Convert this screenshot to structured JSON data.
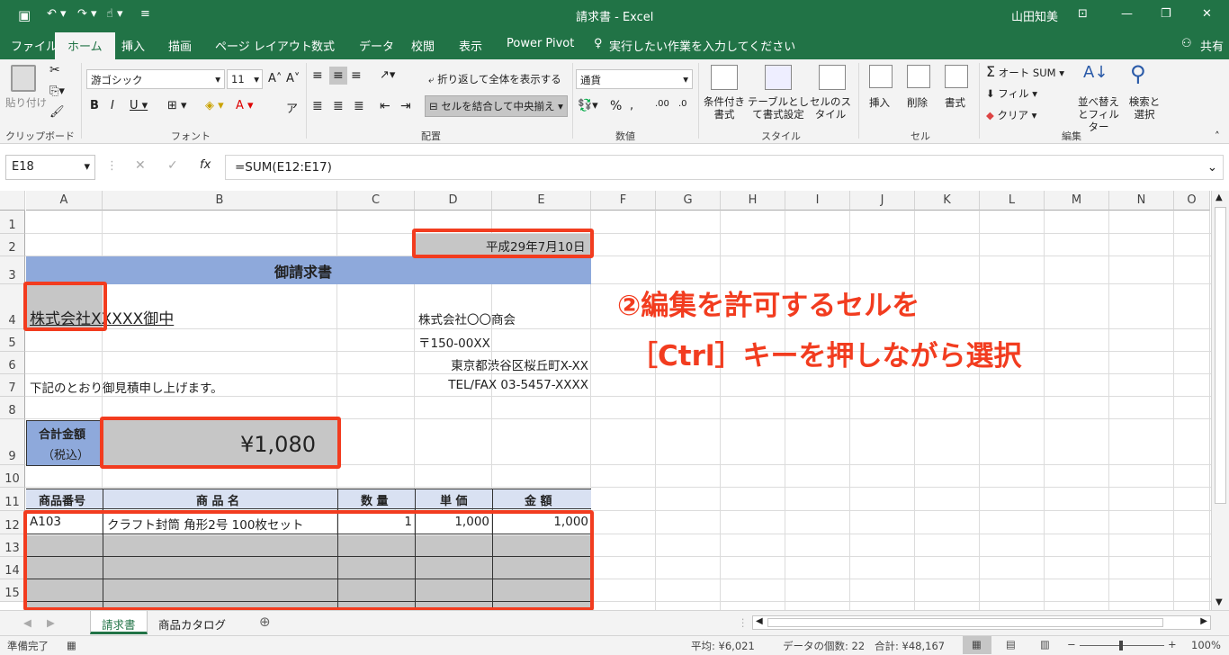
{
  "title": "請求書 - Excel",
  "user": "山田知美",
  "tabs": [
    "ファイル",
    "ホーム",
    "挿入",
    "描画",
    "ページ レイアウト",
    "数式",
    "データ",
    "校閲",
    "表示",
    "Power Pivot",
    "実行したい作業を入力してください"
  ],
  "share": "共有",
  "ribbon": {
    "paste": "貼り付け",
    "clipboard": "クリップボード",
    "font_name": "游ゴシック",
    "font_size": "11",
    "font_group": "フォント",
    "wrap": "折り返して全体を表示する",
    "merge": "セルを結合して中央揃え",
    "align_group": "配置",
    "number_format": "通貨",
    "number_group": "数値",
    "cond_format": "条件付き書式",
    "table_format": "テーブルとして書式設定",
    "cell_style": "セルのスタイル",
    "style_group": "スタイル",
    "insert": "挿入",
    "delete": "削除",
    "format": "書式",
    "cells_group": "セル",
    "autosum": "オート SUM",
    "fill": "フィル",
    "clear": "クリア",
    "sort": "並べ替えとフィルター",
    "find": "検索と選択",
    "edit_group": "編集"
  },
  "namebox": "E18",
  "formula": "=SUM(E12:E17)",
  "fx": "fx",
  "columns": [
    "A",
    "B",
    "C",
    "D",
    "E",
    "F",
    "G",
    "H",
    "I",
    "J",
    "K",
    "L",
    "M",
    "N",
    "O"
  ],
  "rows": [
    "1",
    "2",
    "3",
    "4",
    "5",
    "6",
    "7",
    "8",
    "9",
    "10",
    "11",
    "12",
    "13",
    "14",
    "15"
  ],
  "cells": {
    "date": "平成29年7月10日",
    "heading": "御請求書",
    "client": "株式会社XXXXX御中",
    "company": "株式会社〇〇商会",
    "zip": "〒150-00XX",
    "address": "東京都渋谷区桜丘町X-XX",
    "tel": "TEL/FAX 03-5457-XXXX",
    "note": "下記のとおり御見積申し上げます。",
    "total_label": "合計金額",
    "tax_label": "（税込）",
    "total": "¥1,080",
    "h_code": "商品番号",
    "h_name": "商 品 名",
    "h_qty": "数 量",
    "h_price": "単 価",
    "h_amount": "金 額",
    "r_code": "A103",
    "r_name": "クラフト封筒 角形2号 100枚セット",
    "r_qty": "1",
    "r_price": "1,000",
    "r_amount": "1,000"
  },
  "annotation": {
    "line1": "②編集を許可するセルを",
    "line2": "［Ctrl］キーを押しながら選択"
  },
  "sheets": [
    "請求書",
    "商品カタログ"
  ],
  "status": {
    "ready": "準備完了",
    "average": "平均: ¥6,021",
    "count": "データの個数: 22",
    "sum": "合計: ¥48,167",
    "zoom": "100%"
  }
}
